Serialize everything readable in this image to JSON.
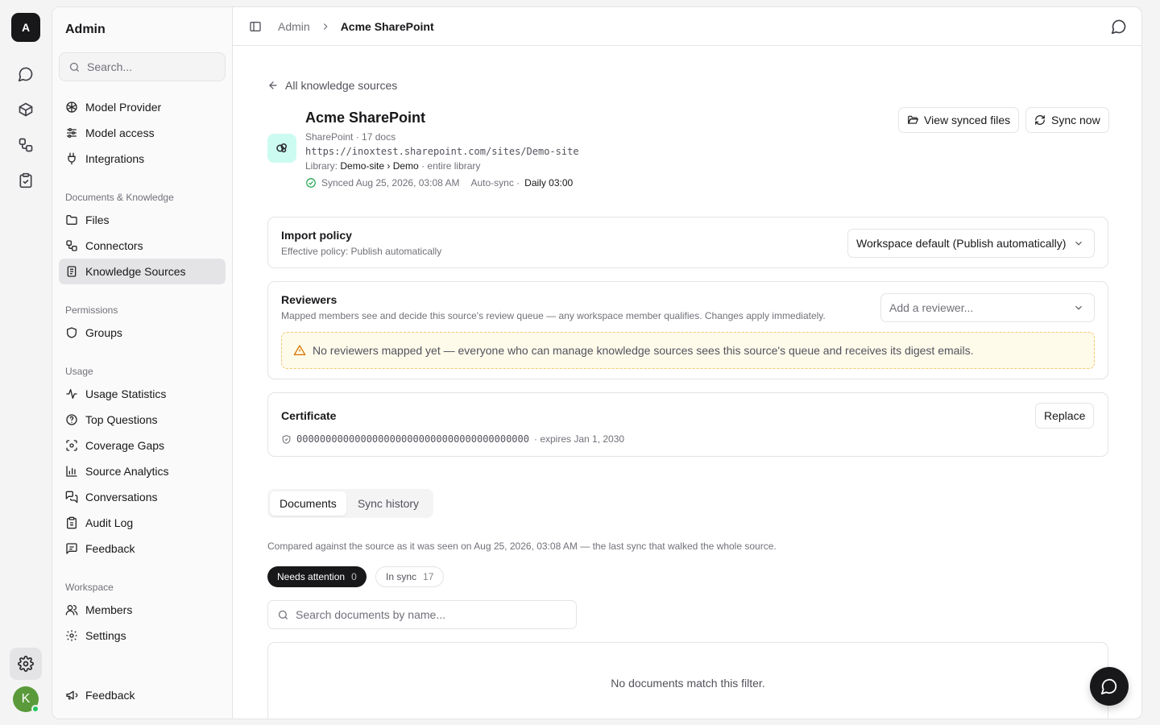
{
  "rail": {
    "logo": "A",
    "avatar": "K",
    "icons": [
      "chat-icon",
      "cube-icon",
      "workflow-icon",
      "clipboard-check-icon"
    ]
  },
  "sidebar": {
    "title": "Admin",
    "search_placeholder": "Search...",
    "items_top": [
      {
        "label": "Model Provider",
        "icon": "model-provider-icon"
      },
      {
        "label": "Model access",
        "icon": "sliders-icon"
      },
      {
        "label": "Integrations",
        "icon": "plug-icon"
      }
    ],
    "docs_heading": "Documents & Knowledge",
    "docs_items": [
      {
        "label": "Files",
        "icon": "folder-icon"
      },
      {
        "label": "Connectors",
        "icon": "connector-icon"
      },
      {
        "label": "Knowledge Sources",
        "icon": "book-icon",
        "active": true
      }
    ],
    "permissions_heading": "Permissions",
    "permissions_items": [
      {
        "label": "Groups",
        "icon": "shield-icon"
      }
    ],
    "usage_heading": "Usage",
    "usage_items": [
      {
        "label": "Usage Statistics",
        "icon": "activity-icon"
      },
      {
        "label": "Top Questions",
        "icon": "question-icon"
      },
      {
        "label": "Coverage Gaps",
        "icon": "scan-icon"
      },
      {
        "label": "Source Analytics",
        "icon": "bar-chart-icon"
      },
      {
        "label": "Conversations",
        "icon": "messages-icon"
      },
      {
        "label": "Audit Log",
        "icon": "clipboard-icon"
      },
      {
        "label": "Feedback",
        "icon": "message-square-icon"
      }
    ],
    "workspace_heading": "Workspace",
    "workspace_items": [
      {
        "label": "Members",
        "icon": "users-icon"
      },
      {
        "label": "Settings",
        "icon": "gear-icon"
      }
    ],
    "footer_item": {
      "label": "Feedback",
      "icon": "megaphone-icon"
    }
  },
  "topbar": {
    "crumbs": [
      "Admin",
      "Acme SharePoint"
    ]
  },
  "source": {
    "back_label": "All knowledge sources",
    "title": "Acme SharePoint",
    "type_line": "SharePoint · 17 docs",
    "url": "https://inoxtest.sharepoint.com/sites/Demo-site",
    "library_prefix": "Library:",
    "library_path": "Demo-site › Demo",
    "library_suffix": "· entire library",
    "synced": "Synced Aug 25, 2026, 03:08 AM",
    "autosync_prefix": "Auto-sync ·",
    "autosync_value": "Daily 03:00",
    "view_files_label": "View synced files",
    "sync_now_label": "Sync now"
  },
  "import_policy": {
    "title": "Import policy",
    "subtitle": "Effective policy: Publish automatically",
    "selected": "Workspace default (Publish automatically)"
  },
  "reviewers": {
    "title": "Reviewers",
    "subtitle": "Mapped members see and decide this source's review queue — any workspace member qualifies. Changes apply immediately.",
    "placeholder": "Add a reviewer...",
    "warning": "No reviewers mapped yet — everyone who can manage knowledge sources sees this source's queue and receives its digest emails."
  },
  "certificate": {
    "title": "Certificate",
    "thumbprint": "0000000000000000000000000000000000000000",
    "expires": "· expires Jan 1, 2030",
    "replace_label": "Replace"
  },
  "documents": {
    "tabs": [
      "Documents",
      "Sync history"
    ],
    "compared": "Compared against the source as it was seen on Aug 25, 2026, 03:08 AM — the last sync that walked the whole source.",
    "filter_attention_label": "Needs attention",
    "filter_attention_count": "0",
    "filter_insync_label": "In sync",
    "filter_insync_count": "17",
    "search_placeholder": "Search documents by name...",
    "empty": "No documents match this filter."
  }
}
